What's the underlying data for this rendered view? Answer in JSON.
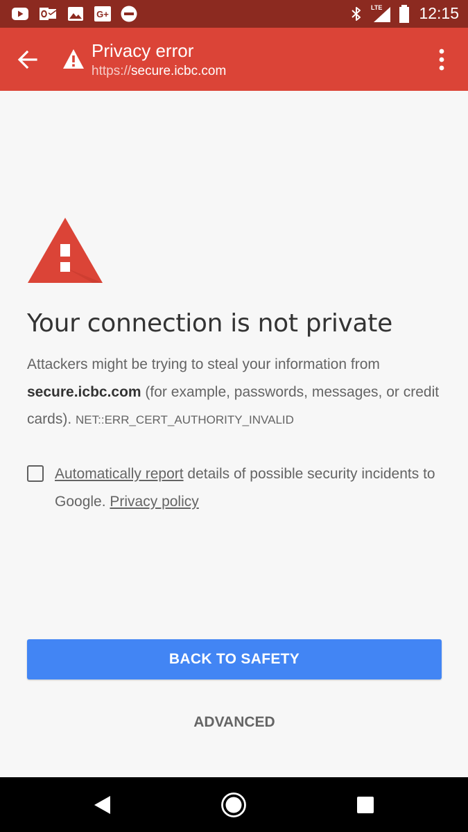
{
  "status_bar": {
    "time": "12:15",
    "network": "LTE",
    "notification_icons": [
      "youtube-icon",
      "outlook-icon",
      "gallery-icon",
      "google-plus-icon",
      "do-not-disturb-icon"
    ],
    "system_icons": [
      "bluetooth-icon",
      "lte-signal-icon",
      "battery-icon"
    ]
  },
  "toolbar": {
    "title": "Privacy error",
    "url_scheme": "https://",
    "url_host": "secure.icbc.com",
    "back_icon": "arrow-back-icon",
    "warning_icon": "warning-icon",
    "menu_icon": "more-vert-icon"
  },
  "interstitial": {
    "heading": "Your connection is not private",
    "body_intro": "Attackers might be trying to steal your information from ",
    "host": "secure.icbc.com",
    "body_rest": " (for example, passwords, messages, or credit cards). ",
    "error_code": "NET::ERR_CERT_AUTHORITY_INVALID",
    "report_link": "Automatically report",
    "report_text": " details of possible security incidents to Google. ",
    "privacy_link": "Privacy policy",
    "report_checked": false,
    "primary_button": "BACK TO SAFETY",
    "advanced_button": "ADVANCED"
  },
  "colors": {
    "status_bar": "#8c2a20",
    "toolbar": "#db4437",
    "warning_red": "#db4437",
    "primary_button": "#4285f4",
    "page_background": "#f7f7f7"
  },
  "nav_bar": {
    "icons": [
      "back-triangle-icon",
      "home-circle-icon",
      "recents-square-icon"
    ]
  }
}
